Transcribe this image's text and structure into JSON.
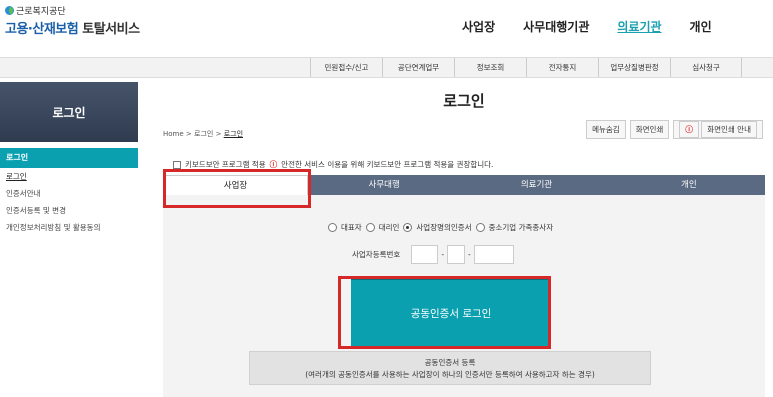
{
  "header": {
    "org": "근로복지공단",
    "title_part1": "고용·산재보험",
    "title_part2": "토탈서비스",
    "nav": [
      "사업장",
      "사무대행기관",
      "의료기관",
      "개인"
    ]
  },
  "subnav": [
    "민원접수/신고",
    "공단연계업무",
    "정보조회",
    "전자통지",
    "업무상질병판정",
    "심사청구"
  ],
  "sidebar": {
    "heading": "로그인",
    "active": "로그인",
    "items": [
      "로그인",
      "인증서안내",
      "인증서등록 및 변경",
      "개인정보처리방침 및 활용동의"
    ]
  },
  "main": {
    "title": "로그인",
    "breadcrumb": {
      "home": "Home",
      "sep": ">",
      "level1": "로그인",
      "level2": "로그인"
    },
    "tools": {
      "hide_menu": "메뉴숨김",
      "print": "화면인쇄",
      "print_guide": "화면인쇄 안내"
    },
    "keyboard_option": "키보드보안 프로그램 적용",
    "keyboard_notice": "안전한 서비스 이용을 위해 키보드보안 프로그램 적용을 권장합니다.",
    "tabs": [
      "사업장",
      "사무대행",
      "의료기관",
      "개인"
    ],
    "radios": [
      "대표자",
      "대리인",
      "사업장명의인증서",
      "중소기업 가족종사자"
    ],
    "bizno_label": "사업자등록번호",
    "bizno_sep": "-",
    "login_button": "공동인증서 로그인",
    "register_title": "공동인증서 등록",
    "register_desc": "(여러개의 공동인증서를 사용하는 사업장이 하나의 인증서만 등록하여 사용하고자 하는 경우)"
  },
  "colors": {
    "accent": "#0aa0b0",
    "tab_bar": "#5a6a82",
    "highlight": "#d62828",
    "brand": "#1a5fa8"
  }
}
